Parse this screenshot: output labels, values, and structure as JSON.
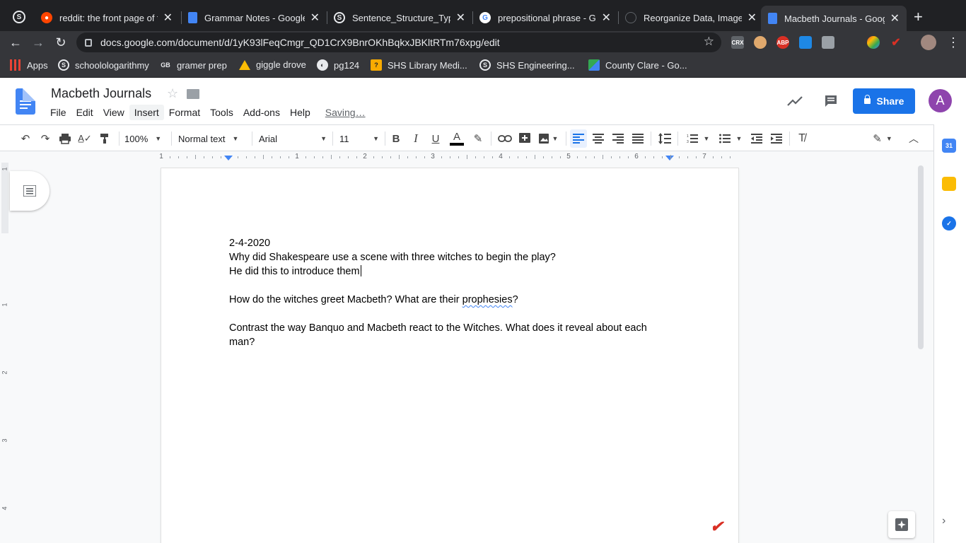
{
  "browser": {
    "tabs": [
      {
        "title": "reddit: the front page of t",
        "icon": "reddit-icon",
        "color": "#ff4500"
      },
      {
        "title": "Grammar Notes - Google",
        "icon": "google-docs-icon",
        "color": "#4285f4"
      },
      {
        "title": "Sentence_Structure_Type",
        "icon": "schoology-icon",
        "color": "#2f6dbd"
      },
      {
        "title": "prepositional phrase - Go",
        "icon": "google-icon",
        "color": "#ffffff"
      },
      {
        "title": "Reorganize Data, Image F",
        "icon": "github-icon",
        "color": "#202124"
      },
      {
        "title": "Macbeth Journals - Goog",
        "icon": "google-docs-icon",
        "color": "#4285f4"
      }
    ],
    "url": "docs.google.com/document/d/1yK93lFeqCmgr_QD1CrX9BnrOKhBqkxJBKltRTm76xpg/edit",
    "extensions": [
      "CRX",
      "ABP"
    ]
  },
  "bookmarks": [
    {
      "label": "Apps",
      "icon": "apps-grid-icon"
    },
    {
      "label": "schoolologarithmy",
      "icon": "schoology-icon"
    },
    {
      "label": "gramer prep",
      "icon": "gb-icon"
    },
    {
      "label": "giggle drove",
      "icon": "google-drive-icon"
    },
    {
      "label": "pg124",
      "icon": "globe-icon"
    },
    {
      "label": "SHS Library Medi...",
      "icon": "library-icon"
    },
    {
      "label": "SHS Engineering...",
      "icon": "schoology-icon"
    },
    {
      "label": "County Clare - Go...",
      "icon": "maps-icon"
    }
  ],
  "docs": {
    "title": "Macbeth Journals",
    "menu": [
      "File",
      "Edit",
      "View",
      "Insert",
      "Format",
      "Tools",
      "Add-ons",
      "Help"
    ],
    "status": "Saving…",
    "share_label": "Share",
    "avatar_letter": "A"
  },
  "toolbar": {
    "zoom": "100%",
    "style": "Normal text",
    "font": "Arial",
    "size": "11"
  },
  "ruler": {
    "numbers": [
      "1",
      "1",
      "2",
      "3",
      "4",
      "5",
      "6",
      "7"
    ],
    "vnumbers": [
      "1",
      "1",
      "2",
      "3",
      "4"
    ]
  },
  "document": {
    "lines": [
      "2-4-2020",
      "Why did Shakespeare use a scene with three witches to begin the play?",
      "He did this to introduce them",
      "",
      "How do the witches greet Macbeth? What are their",
      "prophesies",
      "?",
      "",
      "Contrast the way Banquo and Macbeth react to the Witches. What does it reveal about each",
      "man?"
    ]
  }
}
